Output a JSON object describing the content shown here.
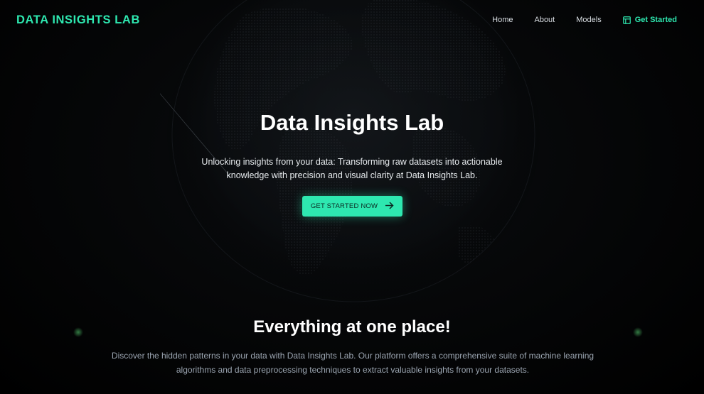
{
  "nav": {
    "brand": "DATA INSIGHTS LAB",
    "links": [
      "Home",
      "About",
      "Models"
    ],
    "cta_label": "Get Started",
    "cta_icon": "layout-icon"
  },
  "hero": {
    "title": "Data Insights Lab",
    "subtitle": "Unlocking insights from your data: Transforming raw datasets into actionable knowledge with precision and visual clarity at Data Insights Lab.",
    "button_label": "GET STARTED NOW",
    "button_icon": "arrow-right-icon"
  },
  "features": {
    "title": "Everything at one place!",
    "description": "Discover the hidden patterns in your data with Data Insights Lab. Our platform offers a comprehensive suite of machine learning algorithms and data preprocessing techniques to extract valuable insights from your datasets."
  },
  "colors": {
    "accent": "#2ee8b0",
    "background": "#000000",
    "text": "#ffffff",
    "muted_text": "#9ba5b1"
  }
}
